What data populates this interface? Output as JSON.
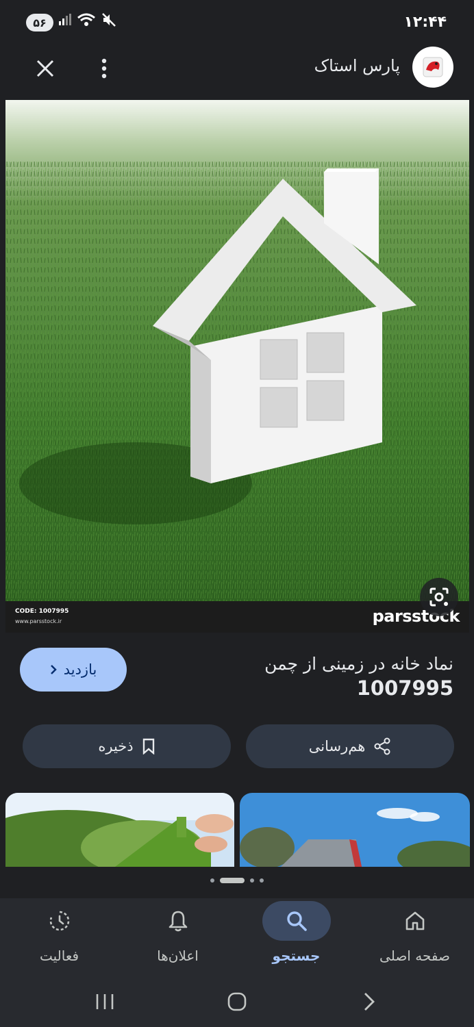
{
  "status_bar": {
    "time": "۱۲:۴۴",
    "badge": "۵۶",
    "icons": [
      "signal-icon",
      "wifi-icon",
      "mute-icon"
    ]
  },
  "header": {
    "site_name": "پارس استاک",
    "icons": [
      "close-icon",
      "more-vert-icon",
      "site-logo-icon"
    ]
  },
  "image": {
    "code_text": "CODE: 1007995",
    "url_text": "www.parsstock.ir",
    "brand_text": "parsstock",
    "lens_icon": "lens-icon"
  },
  "result": {
    "title": "نماد خانه در زمینی از چمن",
    "code": "1007995",
    "visit_label": "بازدید"
  },
  "actions": {
    "share_label": "هم‌رسانی",
    "save_label": "ذخیره"
  },
  "pager": {
    "count": 4,
    "active": 1
  },
  "bottom_nav": {
    "items": [
      {
        "label": "صفحه اصلی",
        "icon": "home-icon",
        "active": false
      },
      {
        "label": "جستجو",
        "icon": "search-icon",
        "active": true
      },
      {
        "label": "اعلان‌ها",
        "icon": "bell-icon",
        "active": false
      },
      {
        "label": "فعالیت",
        "icon": "activity-icon",
        "active": false
      }
    ]
  },
  "colors": {
    "background": "#1f2023",
    "accent": "#a8c7fa",
    "button_bg": "#303845",
    "nav_bg": "#282a2f"
  }
}
